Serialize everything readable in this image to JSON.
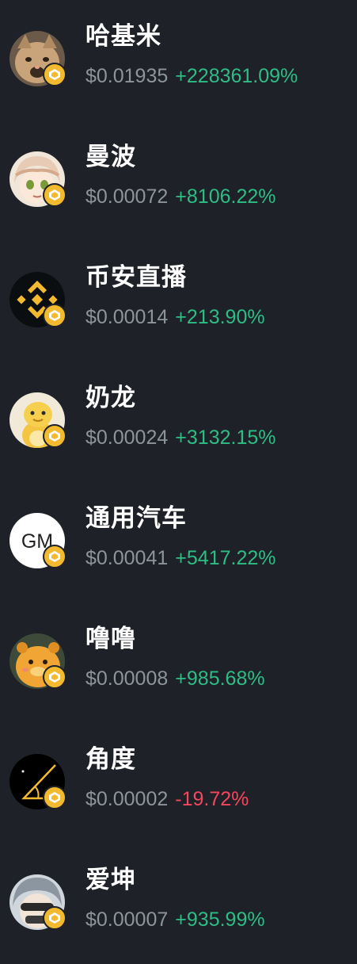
{
  "tokens": [
    {
      "name": "哈基米",
      "price": "$0.01935",
      "change": "+228361.09%",
      "direction": "up",
      "avatar_icon": "cat-meme-icon"
    },
    {
      "name": "曼波",
      "price": "$0.00072",
      "change": "+8106.22%",
      "direction": "up",
      "avatar_icon": "anime-girl-icon"
    },
    {
      "name": "币安直播",
      "price": "$0.00014",
      "change": "+213.90%",
      "direction": "up",
      "avatar_icon": "binance-logo-icon"
    },
    {
      "name": "奶龙",
      "price": "$0.00024",
      "change": "+3132.15%",
      "direction": "up",
      "avatar_icon": "yellow-dragon-icon"
    },
    {
      "name": "通用汽车",
      "price": "$0.00041",
      "change": "+5417.22%",
      "direction": "up",
      "avatar_icon": "gm-logo-icon"
    },
    {
      "name": "噜噜",
      "price": "$0.00008",
      "change": "+985.68%",
      "direction": "up",
      "avatar_icon": "cartoon-creature-icon"
    },
    {
      "name": "角度",
      "price": "$0.00002",
      "change": "-19.72%",
      "direction": "down",
      "avatar_icon": "angle-symbol-icon"
    },
    {
      "name": "爱坤",
      "price": "$0.00007",
      "change": "+935.99%",
      "direction": "up",
      "avatar_icon": "masked-character-icon"
    }
  ],
  "avatar_text": {
    "gm": "GM"
  },
  "colors": {
    "background": "#1e2127",
    "name": "#ffffff",
    "price": "#8e939c",
    "up": "#2ebd85",
    "down": "#f6465d",
    "badge": "#f3ba2f"
  }
}
